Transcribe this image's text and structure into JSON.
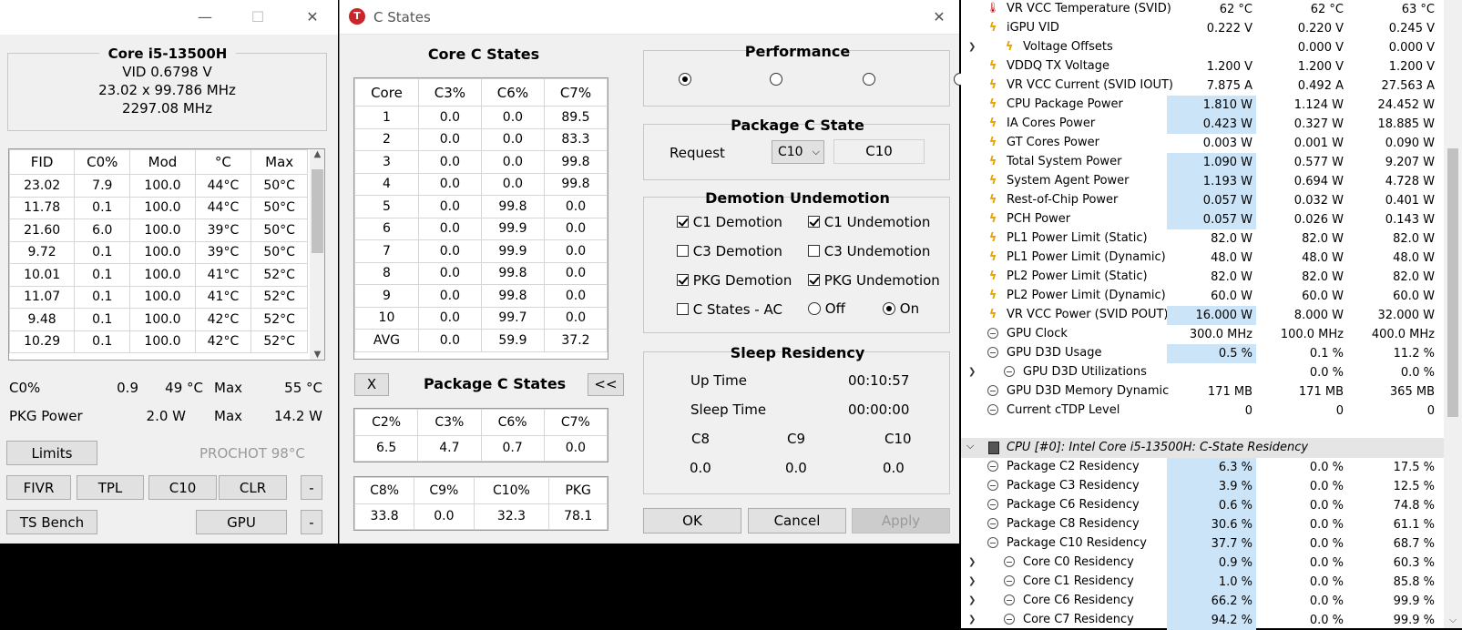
{
  "ts": {
    "cpu_name": "Core i5-13500H",
    "vid": "VID  0.6798 V",
    "multi": "23.02 x 99.786 MHz",
    "freq": "2297.08 MHz",
    "table_headers": [
      "FID",
      "C0%",
      "Mod",
      "°C",
      "Max"
    ],
    "rows": [
      [
        "23.02",
        "7.9",
        "100.0",
        "44°C",
        "50°C"
      ],
      [
        "11.78",
        "0.1",
        "100.0",
        "44°C",
        "50°C"
      ],
      [
        "21.60",
        "6.0",
        "100.0",
        "39°C",
        "50°C"
      ],
      [
        "9.72",
        "0.1",
        "100.0",
        "39°C",
        "50°C"
      ],
      [
        "10.01",
        "0.1",
        "100.0",
        "41°C",
        "52°C"
      ],
      [
        "11.07",
        "0.1",
        "100.0",
        "41°C",
        "52°C"
      ],
      [
        "9.48",
        "0.1",
        "100.0",
        "42°C",
        "52°C"
      ],
      [
        "10.29",
        "0.1",
        "100.0",
        "42°C",
        "52°C"
      ]
    ],
    "c0_label": "C0%",
    "c0_val": "0.9",
    "temp_val": "49 °C",
    "max_label": "Max",
    "max_temp": "55 °C",
    "pkg_label": "PKG Power",
    "pkg_val": "2.0 W",
    "max_label2": "Max",
    "pkg_max": "14.2 W",
    "limits": "Limits",
    "prochot": "PROCHOT 98°C",
    "fivr": "FIVR",
    "tpl": "TPL",
    "c10": "C10",
    "clr": "CLR",
    "dash": "-",
    "tsbench": "TS Bench",
    "gpu": "GPU",
    "dash2": "-",
    "minimize": "—",
    "maximize": "☐",
    "close": "✕"
  },
  "cs": {
    "title": "C States",
    "close": "✕",
    "core_title": "Core C States",
    "core_headers": [
      "Core",
      "C3%",
      "C6%",
      "C7%"
    ],
    "core_rows": [
      [
        "1",
        "0.0",
        "0.0",
        "89.5"
      ],
      [
        "2",
        "0.0",
        "0.0",
        "83.3"
      ],
      [
        "3",
        "0.0",
        "0.0",
        "99.8"
      ],
      [
        "4",
        "0.0",
        "0.0",
        "99.8"
      ],
      [
        "5",
        "0.0",
        "99.8",
        "0.0"
      ],
      [
        "6",
        "0.0",
        "99.9",
        "0.0"
      ],
      [
        "7",
        "0.0",
        "99.9",
        "0.0"
      ],
      [
        "8",
        "0.0",
        "99.8",
        "0.0"
      ],
      [
        "9",
        "0.0",
        "99.8",
        "0.0"
      ],
      [
        "10",
        "0.0",
        "99.7",
        "0.0"
      ],
      [
        "AVG",
        "0.0",
        "59.9",
        "37.2"
      ]
    ],
    "x_btn": "X",
    "pkg_title": "Package C States",
    "back_btn": "<<",
    "pkg_h1": [
      "C2%",
      "C3%",
      "C6%",
      "C7%"
    ],
    "pkg_v1": [
      "6.5",
      "4.7",
      "0.7",
      "0.0"
    ],
    "pkg_h2": [
      "C8%",
      "C9%",
      "C10%",
      "PKG"
    ],
    "pkg_v2": [
      "33.8",
      "0.0",
      "32.3",
      "78.1"
    ],
    "perf_title": "Performance",
    "pkgcs_title": "Package C State",
    "request_label": "Request",
    "request_value": "C10",
    "request_current": "C10",
    "dem_title": "Demotion Undemotion",
    "c1_dem": "C1 Demotion",
    "c1_undem": "C1 Undemotion",
    "c3_dem": "C3 Demotion",
    "c3_undem": "C3 Undemotion",
    "pkg_dem": "PKG Demotion",
    "pkg_undem": "PKG Undemotion",
    "cs_ac": "C States - AC",
    "off": "Off",
    "on": "On",
    "sleep_title": "Sleep Residency",
    "uptime_label": "Up Time",
    "uptime": "00:10:57",
    "sleeptime_label": "Sleep Time",
    "sleeptime": "00:00:00",
    "c8": "C8",
    "c9": "C9",
    "c10": "C10",
    "c8v": "0.0",
    "c9v": "0.0",
    "c10v": "0.0",
    "ok": "OK",
    "cancel": "Cancel",
    "apply": "Apply"
  },
  "hw": {
    "rows": [
      {
        "icon": "therm",
        "exp": "",
        "name": "VR VCC Temperature (SVID)",
        "v": [
          "62 °C",
          "62 °C",
          "63 °C"
        ],
        "hl": false
      },
      {
        "icon": "bolt",
        "exp": "",
        "name": "iGPU VID",
        "v": [
          "0.222 V",
          "0.220 V",
          "0.245 V"
        ],
        "hl": false
      },
      {
        "icon": "bolt",
        "exp": ">",
        "name": "Voltage Offsets",
        "v": [
          "",
          "0.000 V",
          "0.000 V"
        ],
        "hl": false,
        "indent": true
      },
      {
        "icon": "bolt",
        "exp": "",
        "name": "VDDQ TX Voltage",
        "v": [
          "1.200 V",
          "1.200 V",
          "1.200 V"
        ],
        "hl": false
      },
      {
        "icon": "bolt",
        "exp": "",
        "name": "VR VCC Current (SVID IOUT)",
        "v": [
          "7.875 A",
          "0.492 A",
          "27.563 A"
        ],
        "hl": false
      },
      {
        "icon": "bolt",
        "exp": "",
        "name": "CPU Package Power",
        "v": [
          "1.810 W",
          "1.124 W",
          "24.452 W"
        ],
        "hl": true
      },
      {
        "icon": "bolt",
        "exp": "",
        "name": "IA Cores Power",
        "v": [
          "0.423 W",
          "0.327 W",
          "18.885 W"
        ],
        "hl": true
      },
      {
        "icon": "bolt",
        "exp": "",
        "name": "GT Cores Power",
        "v": [
          "0.003 W",
          "0.001 W",
          "0.090 W"
        ],
        "hl": false
      },
      {
        "icon": "bolt",
        "exp": "",
        "name": "Total System Power",
        "v": [
          "1.090 W",
          "0.577 W",
          "9.207 W"
        ],
        "hl": true
      },
      {
        "icon": "bolt",
        "exp": "",
        "name": "System Agent Power",
        "v": [
          "1.193 W",
          "0.694 W",
          "4.728 W"
        ],
        "hl": true
      },
      {
        "icon": "bolt",
        "exp": "",
        "name": "Rest-of-Chip Power",
        "v": [
          "0.057 W",
          "0.032 W",
          "0.401 W"
        ],
        "hl": true
      },
      {
        "icon": "bolt",
        "exp": "",
        "name": "PCH Power",
        "v": [
          "0.057 W",
          "0.026 W",
          "0.143 W"
        ],
        "hl": true
      },
      {
        "icon": "bolt",
        "exp": "",
        "name": "PL1 Power Limit (Static)",
        "v": [
          "82.0 W",
          "82.0 W",
          "82.0 W"
        ],
        "hl": false
      },
      {
        "icon": "bolt",
        "exp": "",
        "name": "PL1 Power Limit (Dynamic)",
        "v": [
          "48.0 W",
          "48.0 W",
          "48.0 W"
        ],
        "hl": false
      },
      {
        "icon": "bolt",
        "exp": "",
        "name": "PL2 Power Limit (Static)",
        "v": [
          "82.0 W",
          "82.0 W",
          "82.0 W"
        ],
        "hl": false
      },
      {
        "icon": "bolt",
        "exp": "",
        "name": "PL2 Power Limit (Dynamic)",
        "v": [
          "60.0 W",
          "60.0 W",
          "60.0 W"
        ],
        "hl": false
      },
      {
        "icon": "bolt",
        "exp": "",
        "name": "VR VCC Power (SVID POUT)",
        "v": [
          "16.000 W",
          "8.000 W",
          "32.000 W"
        ],
        "hl": true
      },
      {
        "icon": "clk",
        "exp": "",
        "name": "GPU Clock",
        "v": [
          "300.0 MHz",
          "100.0 MHz",
          "400.0 MHz"
        ],
        "hl": false
      },
      {
        "icon": "clk",
        "exp": "",
        "name": "GPU D3D Usage",
        "v": [
          "0.5 %",
          "0.1 %",
          "11.2 %"
        ],
        "hl": true
      },
      {
        "icon": "clk",
        "exp": ">",
        "name": "GPU D3D Utilizations",
        "v": [
          "",
          "0.0 %",
          "0.0 %"
        ],
        "hl": false,
        "indent": true
      },
      {
        "icon": "clk",
        "exp": "",
        "name": "GPU D3D Memory Dynamic",
        "v": [
          "171 MB",
          "171 MB",
          "365 MB"
        ],
        "hl": false
      },
      {
        "icon": "clk",
        "exp": "",
        "name": "Current cTDP Level",
        "v": [
          "0",
          "0",
          "0"
        ],
        "hl": false
      }
    ],
    "section": "CPU [#0]: Intel Core i5-13500H: C-State Residency",
    "rows2": [
      {
        "exp": "",
        "name": "Package C2 Residency",
        "v": [
          "6.3 %",
          "0.0 %",
          "17.5 %"
        ],
        "hl": true
      },
      {
        "exp": "",
        "name": "Package C3 Residency",
        "v": [
          "3.9 %",
          "0.0 %",
          "12.5 %"
        ],
        "hl": true
      },
      {
        "exp": "",
        "name": "Package C6 Residency",
        "v": [
          "0.6 %",
          "0.0 %",
          "74.8 %"
        ],
        "hl": true
      },
      {
        "exp": "",
        "name": "Package C8 Residency",
        "v": [
          "30.6 %",
          "0.0 %",
          "61.1 %"
        ],
        "hl": true
      },
      {
        "exp": "",
        "name": "Package C10 Residency",
        "v": [
          "37.7 %",
          "0.0 %",
          "68.7 %"
        ],
        "hl": true
      },
      {
        "exp": ">",
        "name": "Core C0 Residency",
        "v": [
          "0.9 %",
          "0.0 %",
          "60.3 %"
        ],
        "hl": true,
        "indent": true
      },
      {
        "exp": ">",
        "name": "Core C1 Residency",
        "v": [
          "1.0 %",
          "0.0 %",
          "85.8 %"
        ],
        "hl": true,
        "indent": true
      },
      {
        "exp": ">",
        "name": "Core C6 Residency",
        "v": [
          "66.2 %",
          "0.0 %",
          "99.9 %"
        ],
        "hl": true,
        "indent": true
      },
      {
        "exp": ">",
        "name": "Core C7 Residency",
        "v": [
          "94.2 %",
          "0.0 %",
          "99.9 %"
        ],
        "hl": true,
        "indent": true
      }
    ]
  }
}
